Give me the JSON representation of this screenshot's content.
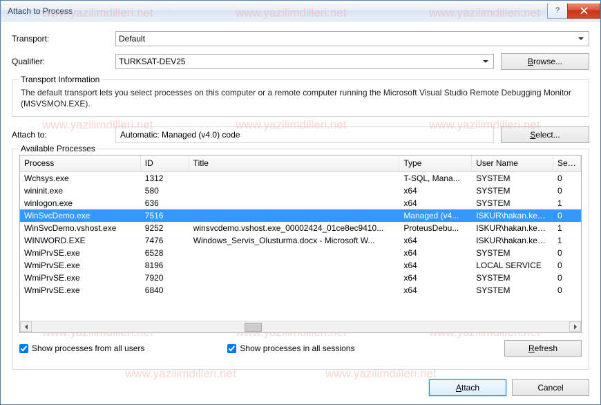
{
  "window": {
    "title": "Attach to Process"
  },
  "labels": {
    "transport": "Transport:",
    "qualifier": "Qualifier:",
    "attach_to": "Attach to:",
    "available": "Available Processes",
    "transport_info_legend": "Transport Information",
    "browse": "Browse...",
    "select": "Select...",
    "refresh": "Refresh",
    "attach": "Attach",
    "cancel": "Cancel",
    "show_all_users": "Show processes from all users",
    "show_all_sessions": "Show processes in all sessions"
  },
  "transport": {
    "value": "Default"
  },
  "qualifier": {
    "value": "TURKSAT-DEV25"
  },
  "transport_info": "The default transport lets you select processes on this computer or a remote computer running the Microsoft Visual Studio Remote Debugging Monitor (MSVSMON.EXE).",
  "attach_to_value": "Automatic: Managed (v4.0) code",
  "columns": {
    "process": "Process",
    "id": "ID",
    "title": "Title",
    "type": "Type",
    "user": "User Name",
    "session": "Session"
  },
  "rows": [
    {
      "process": "Wchsys.exe",
      "id": "1312",
      "title": "",
      "type": "T-SQL, Mana...",
      "user": "SYSTEM",
      "session": "0",
      "sel": false
    },
    {
      "process": "wininit.exe",
      "id": "580",
      "title": "",
      "type": "x64",
      "user": "SYSTEM",
      "session": "0",
      "sel": false
    },
    {
      "process": "winlogon.exe",
      "id": "636",
      "title": "",
      "type": "x64",
      "user": "SYSTEM",
      "session": "1",
      "sel": false
    },
    {
      "process": "WinSvcDemo.exe",
      "id": "7516",
      "title": "",
      "type": "Managed (v4...",
      "user": "ISKUR\\hakan.keskin [...",
      "session": "0",
      "sel": true
    },
    {
      "process": "WinSvcDemo.vshost.exe",
      "id": "9252",
      "title": "winsvcdemo.vshost.exe_00002424_01ce8ec9410...",
      "type": "ProteusDebu...",
      "user": "ISKUR\\hakan.keskin [...",
      "session": "1",
      "sel": false
    },
    {
      "process": "WINWORD.EXE",
      "id": "7476",
      "title": "Windows_Servis_Olusturma.docx - Microsoft W...",
      "type": "x64",
      "user": "ISKUR\\hakan.keskin [...",
      "session": "1",
      "sel": false
    },
    {
      "process": "WmiPrvSE.exe",
      "id": "6528",
      "title": "",
      "type": "x64",
      "user": "SYSTEM",
      "session": "0",
      "sel": false
    },
    {
      "process": "WmiPrvSE.exe",
      "id": "8196",
      "title": "",
      "type": "x64",
      "user": "LOCAL SERVICE",
      "session": "0",
      "sel": false
    },
    {
      "process": "WmiPrvSE.exe",
      "id": "7920",
      "title": "",
      "type": "x64",
      "user": "SYSTEM",
      "session": "0",
      "sel": false
    },
    {
      "process": "WmiPrvSE.exe",
      "id": "6840",
      "title": "",
      "type": "x64",
      "user": "SYSTEM",
      "session": "0",
      "sel": false
    }
  ],
  "checks": {
    "all_users": true,
    "all_sessions": true
  },
  "watermark_text": "www.yazilimdilleri.net"
}
